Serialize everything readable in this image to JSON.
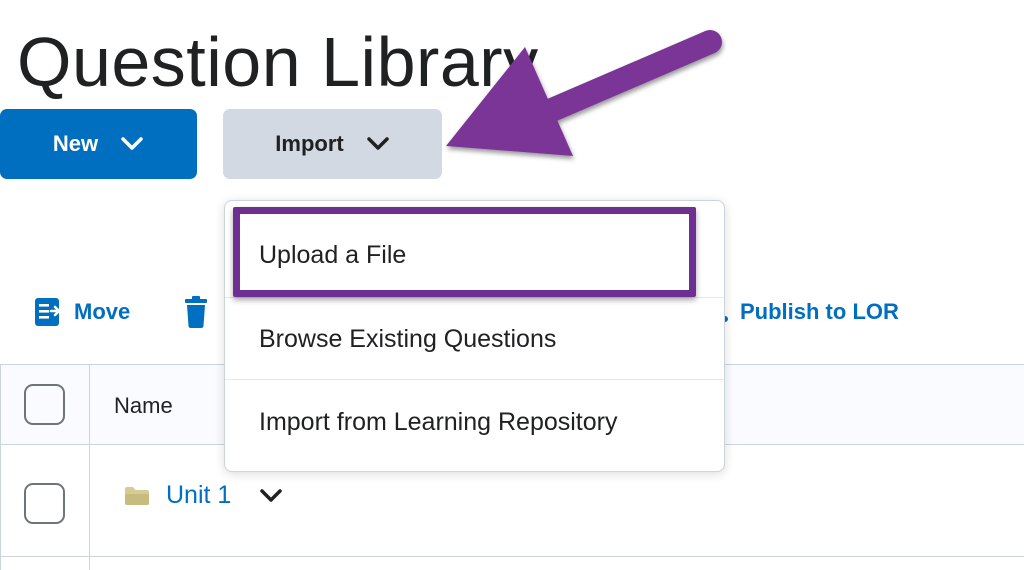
{
  "page": {
    "title": "Question Library"
  },
  "buttons": {
    "new_label": "New",
    "import_label": "Import"
  },
  "toolbar": {
    "move_label": "Move",
    "publish_label": "Publish to LOR"
  },
  "import_menu": {
    "items": [
      {
        "label": "Upload a File"
      },
      {
        "label": "Browse Existing Questions"
      },
      {
        "label": "Import from Learning Repository"
      }
    ]
  },
  "table": {
    "header": {
      "name_label": "Name"
    },
    "rows": [
      {
        "name": "Unit 1"
      }
    ]
  },
  "colors": {
    "primary_blue": "#006fbf",
    "import_gray": "#d3d9e3",
    "annotation_purple": "#7a3596",
    "folder_tan": "#d5cb93"
  }
}
